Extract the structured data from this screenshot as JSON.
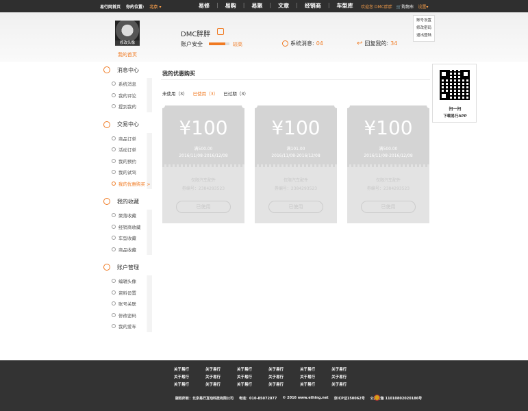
{
  "topbar": {
    "home": "易行网首页",
    "location_label": "你的位置:",
    "city": "北京",
    "nav": [
      "易修",
      "易购",
      "易聚",
      "文章",
      "经销商",
      "车型库"
    ],
    "welcome": "欢迎您 DMC胖胖",
    "cart": "购物车",
    "settings": "设置"
  },
  "dropdown": [
    "账号设置",
    "修改密码",
    "退出登陆"
  ],
  "header": {
    "avatar_label": "修改头像",
    "home_link": "我的首页",
    "username": "DMC胖胖",
    "security_label": "账户安全",
    "security_progress": 0.8,
    "security_level": "较高",
    "sys_msg_label": "系统消息:",
    "sys_msg_count": "04",
    "reply_label": "回复我的:",
    "reply_count": "34"
  },
  "sidebar": [
    {
      "title": "消息中心",
      "items": [
        "系统消息",
        "我的评论",
        "提到我的"
      ]
    },
    {
      "title": "交易中心",
      "items": [
        "商品订单",
        "活动订单",
        "我的预约",
        "我的试驾",
        "我的优惠购买 >"
      ]
    },
    {
      "title": "我的收藏",
      "items": [
        "聚落收藏",
        "经销商收藏",
        "车型收藏",
        "商品收藏"
      ]
    },
    {
      "title": "账户管理",
      "items": [
        "编辑头像",
        "资料设置",
        "账号关联",
        "修改密码",
        "我的爱车"
      ]
    }
  ],
  "main": {
    "title": "我的优惠购买",
    "tabs": [
      "未使用（3）",
      "已使用（3）",
      "已过期（3）"
    ],
    "coupons": [
      {
        "amount": "¥100",
        "cond": "满500.00",
        "date": "2016/11/08-2016/12/08",
        "scope": "仅限汽车配件",
        "code": "券编号：2384293523",
        "btn": "已使用"
      },
      {
        "amount": "¥100",
        "cond": "满101.00",
        "date": "2016/11/08-2016/12/08",
        "scope": "仅限汽车配件",
        "code": "券编号：2384293523",
        "btn": "已使用"
      },
      {
        "amount": "¥100",
        "cond": "满500.00",
        "date": "2016/11/08-2016/12/08",
        "scope": "仅限汽车配件",
        "code": "券编号：2384293523",
        "btn": "已使用"
      }
    ]
  },
  "qr": {
    "line1": "扫一扫",
    "line2": "下载易行APP"
  },
  "footer": {
    "links": [
      [
        "关于易行",
        "关于易行",
        "关于易行"
      ],
      [
        "关于易行",
        "关于易行",
        "关于易行"
      ],
      [
        "关于易行",
        "关于易行",
        "关于易行"
      ],
      [
        "关于易行",
        "关于易行",
        "关于易行"
      ],
      [
        "关于易行",
        "关于易行",
        "关于易行"
      ],
      [
        "关于易行",
        "关于易行",
        "关于易行"
      ]
    ],
    "copyright": "版权所有：北京易行互动科技有限公司",
    "phone": "电话：010-85072077",
    "year": "© 2016 www.ething.net",
    "icp": "京ICP证150062号",
    "security": "公网安备 11010802020186号"
  }
}
